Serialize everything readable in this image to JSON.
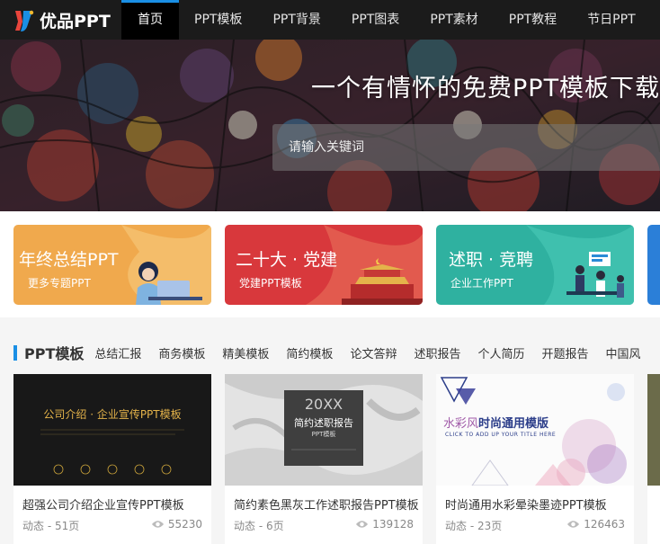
{
  "brand": {
    "logo_text": "优品PPT",
    "accent": "#1a8fe5"
  },
  "nav": [
    {
      "label": "首页",
      "active": true
    },
    {
      "label": "PPT模板"
    },
    {
      "label": "PPT背景"
    },
    {
      "label": "PPT图表"
    },
    {
      "label": "PPT素材"
    },
    {
      "label": "PPT教程"
    },
    {
      "label": "节日PPT"
    }
  ],
  "hero": {
    "title": "一个有情怀的免费PPT模板下载网",
    "search_placeholder": "请输入关键词"
  },
  "promos": [
    {
      "title": "年终总结PPT",
      "subtitle": "更多专题PPT",
      "color": "#f0a94d"
    },
    {
      "title": "二十大 · 党建",
      "subtitle": "党建PPT模板",
      "color": "#d8383c"
    },
    {
      "title": "述职 · 竞聘",
      "subtitle": "企业工作PPT",
      "color": "#2fb1a0"
    }
  ],
  "section": {
    "title": "PPT模板",
    "categories": [
      "总结汇报",
      "商务模板",
      "精美模板",
      "简约模板",
      "论文答辩",
      "述职报告",
      "个人简历",
      "开题报告",
      "中国风"
    ]
  },
  "cards": [
    {
      "title": "超强公司介绍企业宣传PPT模板",
      "meta": "动态 - 51页",
      "views": "55230",
      "thumb_text": "公司介绍 · 企业宣传PPT模板"
    },
    {
      "title": "简约素色黑灰工作述职报告PPT模板",
      "meta": "动态 - 6页",
      "views": "139128",
      "thumb_year": "20XX",
      "thumb_text": "简约述职报告",
      "thumb_sub": "PPT模板"
    },
    {
      "title": "时尚通用水彩晕染墨迹PPT模板",
      "meta": "动态 - 23页",
      "views": "126463",
      "thumb_text_a": "水彩风",
      "thumb_text_b": "时尚通用模版",
      "thumb_sub": "CLICK TO ADD UP YOUR TITLE HERE"
    }
  ]
}
